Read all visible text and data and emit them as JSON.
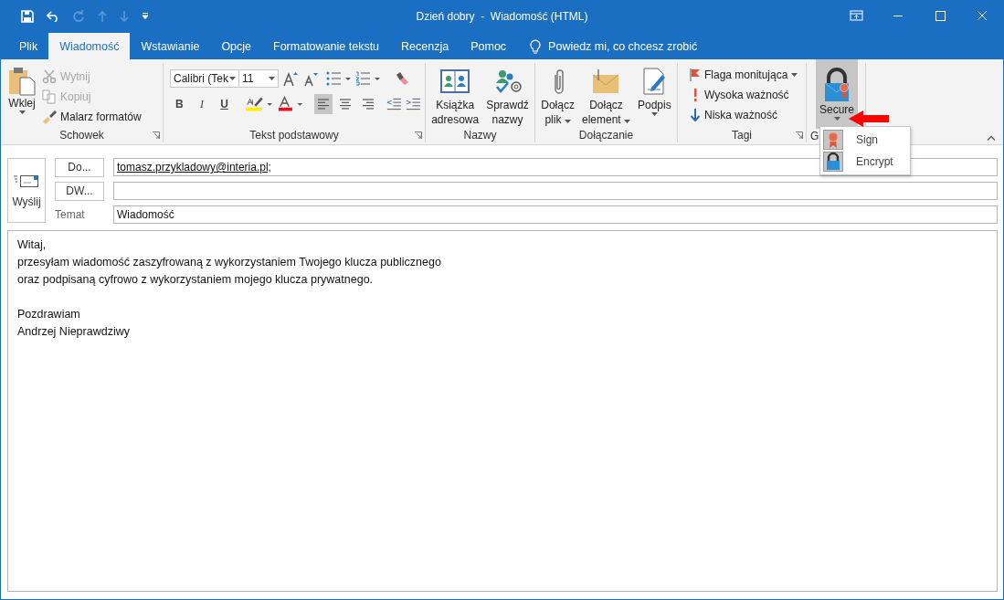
{
  "window": {
    "title": "Dzień dobry  -  Wiadomość (HTML)"
  },
  "tabs": [
    {
      "label": "Plik",
      "selected": false
    },
    {
      "label": "Wiadomość",
      "selected": true
    },
    {
      "label": "Wstawianie",
      "selected": false
    },
    {
      "label": "Opcje",
      "selected": false
    },
    {
      "label": "Formatowanie tekstu",
      "selected": false
    },
    {
      "label": "Recenzja",
      "selected": false
    },
    {
      "label": "Pomoc",
      "selected": false
    }
  ],
  "tell_me": "Powiedz mi, co chcesz zrobić",
  "ribbon": {
    "clipboard": {
      "label": "Schowek",
      "paste": "Wklej",
      "cut": {
        "label": "Wytnij",
        "disabled": true
      },
      "copy": {
        "label": "Kopiuj",
        "disabled": true
      },
      "painter": {
        "label": "Malarz formatów",
        "disabled": false
      }
    },
    "basic_text": {
      "label": "Tekst podstawowy",
      "font": "Calibri (Tek",
      "size": "11",
      "bold": "B",
      "italic": "I",
      "underline": "U",
      "alignment": [
        {
          "kind": "left",
          "selected": true
        },
        {
          "kind": "center",
          "selected": false
        },
        {
          "kind": "right",
          "selected": false
        }
      ]
    },
    "names": {
      "label": "Nazwy",
      "buttons": [
        {
          "kind": "address_book",
          "lines": [
            "Książka",
            "adresowa"
          ]
        },
        {
          "kind": "check_names",
          "lines": [
            "Sprawdź",
            "nazwy"
          ]
        }
      ]
    },
    "include": {
      "label": "Dołączanie",
      "buttons": [
        {
          "kind": "attach_file",
          "lines": [
            "Dołącz",
            "plik"
          ]
        },
        {
          "kind": "attach_item",
          "lines": [
            "Dołącz",
            "element"
          ]
        },
        {
          "kind": "signature",
          "lines": [
            "Podpis"
          ]
        }
      ]
    },
    "tags": {
      "label": "Tagi",
      "items": [
        {
          "kind": "flag",
          "label": "Flaga monitująca"
        },
        {
          "kind": "high",
          "label": "Wysoka ważność"
        },
        {
          "kind": "low",
          "label": "Niska ważność"
        }
      ]
    },
    "secure": {
      "label": "G",
      "button": "Secure",
      "expanded": true,
      "menu": [
        {
          "kind": "sign",
          "label": "Sign"
        },
        {
          "kind": "encrypt",
          "label": "Encrypt"
        }
      ]
    }
  },
  "compose": {
    "send": "Wyślij",
    "to_button": "Do...",
    "to_value": "tomasz.przykladowy@interia.pl;",
    "cc_button": "DW...",
    "subject_label": "Temat",
    "subject_value": "Wiadomość"
  },
  "body": {
    "paragraphs": [
      {
        "lines": [
          "Witaj,",
          "przesyłam wiadomość zaszyfrowaną z wykorzystaniem Twojego klucza publicznego",
          "oraz podpisaną cyfrowo z wykorzystaniem mojego klucza prywatnego."
        ]
      },
      {
        "lines": [
          "Pozdrawiam",
          "Andrzej Nieprawdziwy"
        ]
      }
    ]
  }
}
